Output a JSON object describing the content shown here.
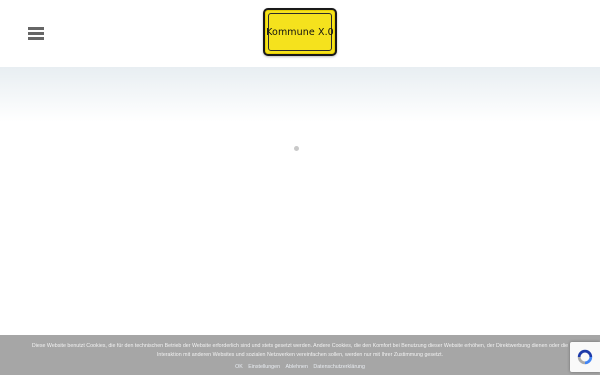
{
  "header": {
    "menu_icon": "hamburger-menu-icon",
    "logo_text": "Kommune X.0",
    "logo_colors": {
      "fill": "#f5e21d",
      "border": "#1a1a1a"
    }
  },
  "loading": {
    "indicator": "spinner-dot-icon"
  },
  "cookie_banner": {
    "text": "Diese Website benutzt Cookies, die für den technischen Betrieb der Website erforderlich sind und stets gesetzt werden. Andere Cookies, die den Komfort bei Benutzung dieser Website erhöhen, der Direktwerbung dienen oder die Interaktion mit anderen Websites und sozialen Netzwerken vereinfachen sollen, werden nur mit Ihrer Zustimmung gesetzt.",
    "links": [
      "OK",
      "Einstellungen",
      "Ablehnen",
      "Datenschutzerklärung"
    ],
    "background": "#a6a6a6"
  },
  "recaptcha": {
    "icon": "recaptcha-icon"
  }
}
